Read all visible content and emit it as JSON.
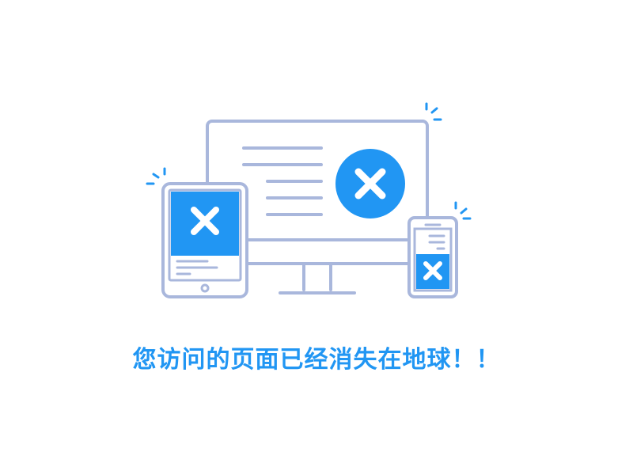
{
  "message": {
    "text": "您访问的页面已经消失在地球！！"
  },
  "colors": {
    "outline": "#a9b7dc",
    "accent": "#2196f3",
    "background": "#ffffff",
    "icon_mark": "#ffffff"
  },
  "icons": {
    "monitor": "desktop-monitor-icon",
    "tablet": "tablet-icon",
    "phone": "smartphone-icon",
    "error": "close-x-icon"
  }
}
